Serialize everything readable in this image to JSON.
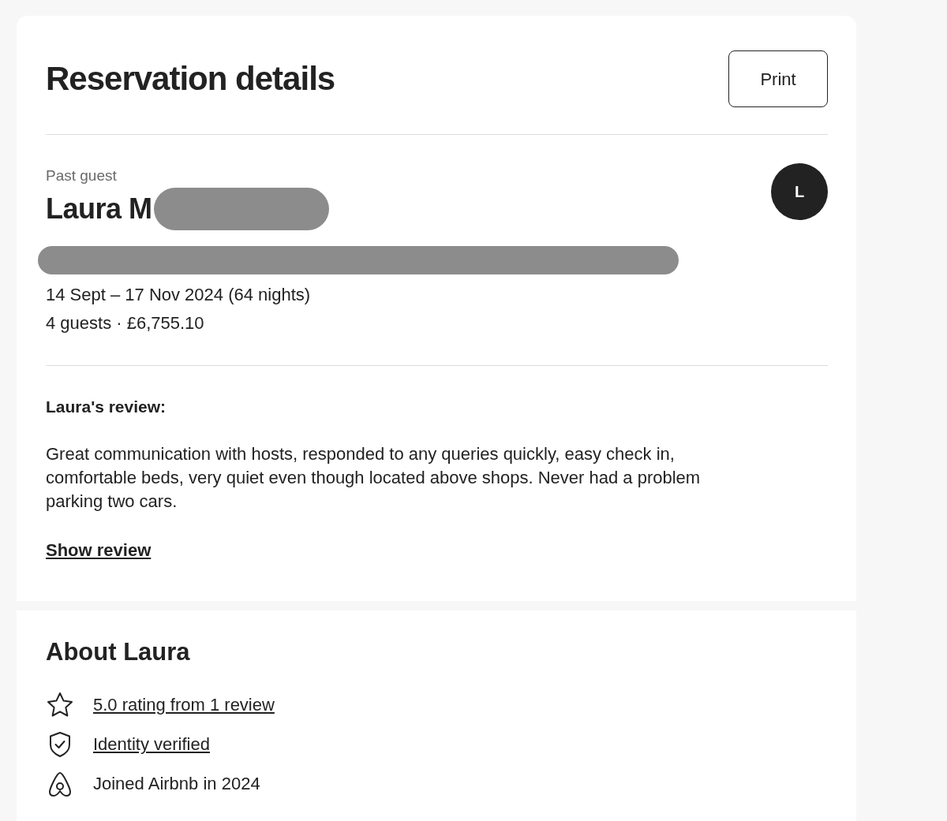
{
  "title": "Reservation details",
  "print_button": "Print",
  "guest": {
    "status": "Past guest",
    "name": "Laura M",
    "avatar_initial": "L",
    "dates": "14 Sept – 17 Nov 2024 (64 nights)",
    "summary": "4 guests · £6,755.10"
  },
  "review": {
    "heading": "Laura's review:",
    "text": "Great communication with hosts, responded to any queries quickly, easy check in, comfortable beds, very quiet even though located above shops. Never had a problem parking two cars.",
    "link": "Show review"
  },
  "about": {
    "heading": "About Laura",
    "items": [
      {
        "kind": "star",
        "text": "5.0 rating from 1 review",
        "link": true
      },
      {
        "kind": "shield",
        "text": "Identity verified",
        "link": true
      },
      {
        "kind": "logo",
        "text": "Joined Airbnb in 2024",
        "link": false
      }
    ]
  }
}
